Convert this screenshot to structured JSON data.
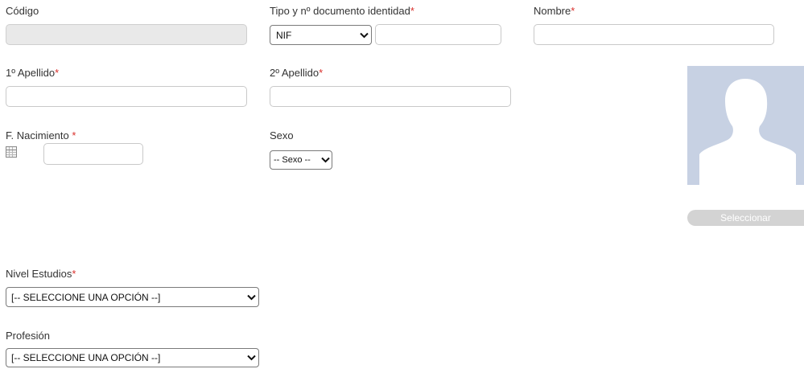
{
  "form": {
    "codigo": {
      "label": "Código",
      "value": ""
    },
    "tipo_documento": {
      "label": "Tipo y nº documento identidad",
      "required_mark": "*",
      "selected": "NIF",
      "number_value": ""
    },
    "nombre": {
      "label": "Nombre",
      "required_mark": "*",
      "value": ""
    },
    "apellido1": {
      "label": "1º Apellido",
      "required_mark": "*",
      "value": ""
    },
    "apellido2": {
      "label": "2º Apellido",
      "required_mark": "*",
      "value": ""
    },
    "nacimiento": {
      "label": "F. Nacimiento ",
      "required_mark": "*",
      "value": ""
    },
    "sexo": {
      "label": "Sexo",
      "selected": "-- Sexo --"
    },
    "nivel_estudios": {
      "label": "Nivel Estudios",
      "required_mark": "*",
      "selected": "[-- SELECCIONE UNA OPCIÓN --]"
    },
    "profesion": {
      "label": "Profesión",
      "selected": "[-- SELECCIONE UNA OPCIÓN --]"
    }
  },
  "photo": {
    "icon": "avatar-silhouette",
    "select_label": "Seleccionar"
  },
  "colors": {
    "required": "#d9302c",
    "avatar_bg": "#c7d1e3",
    "avatar_fg": "#ffffff",
    "button_bg": "#d3d3d3"
  }
}
